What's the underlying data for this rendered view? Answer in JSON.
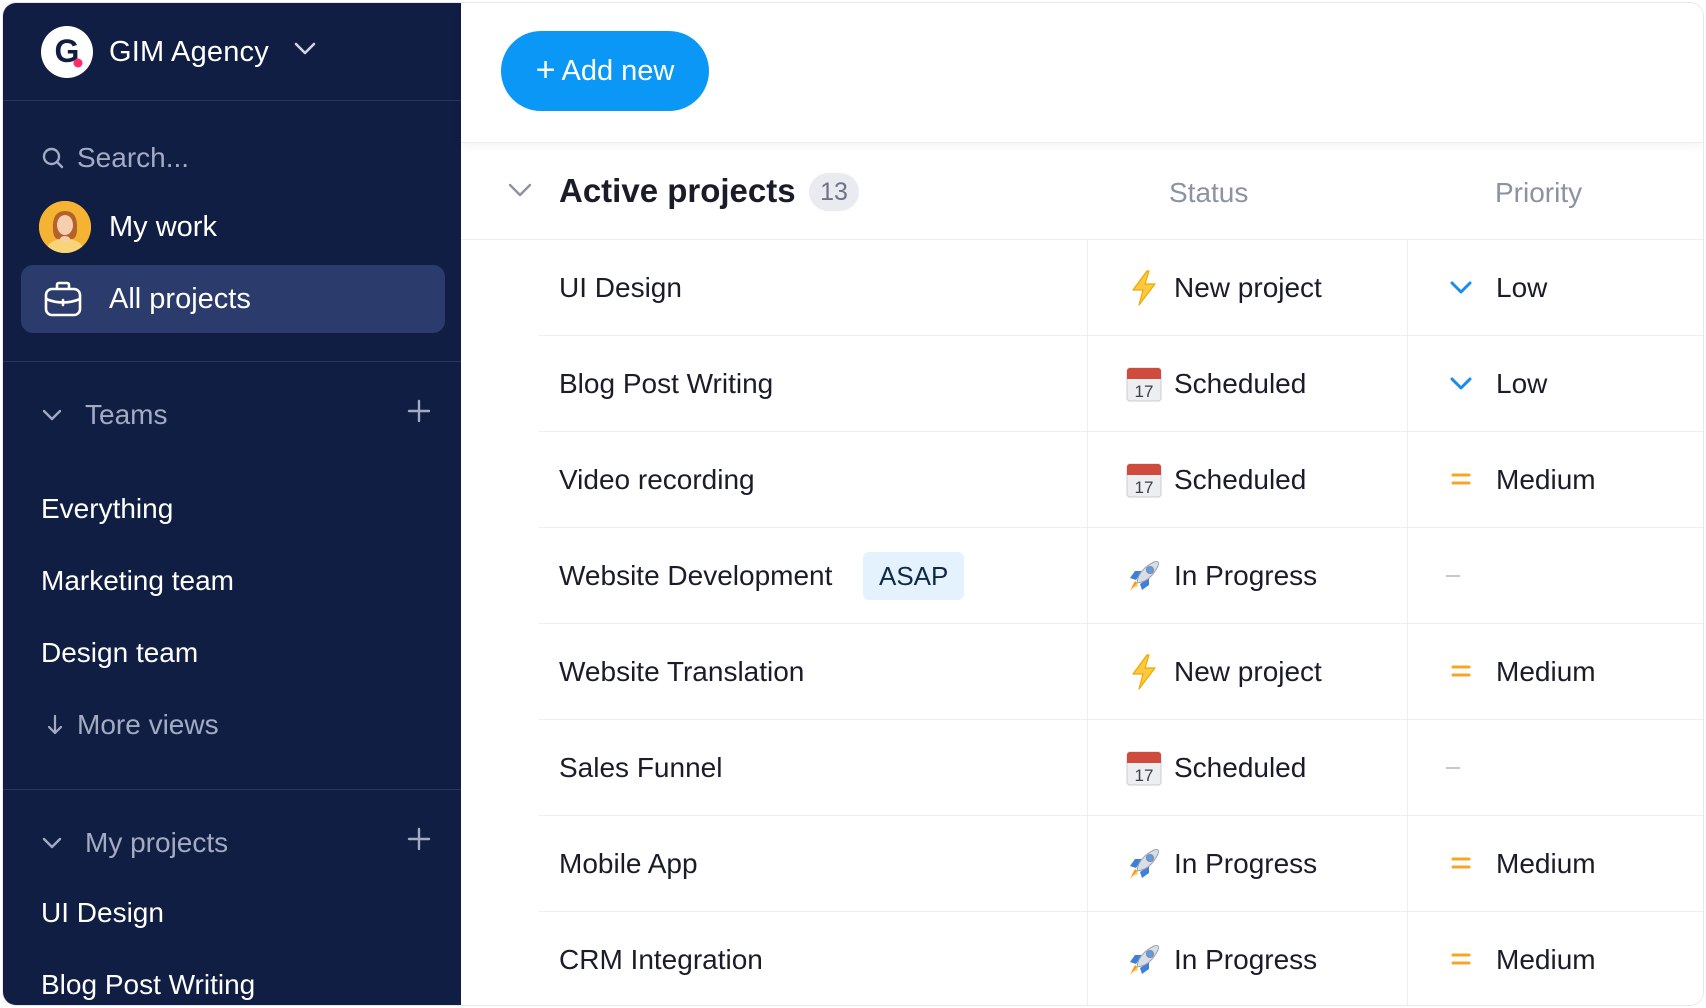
{
  "workspace": {
    "name": "GIM Agency",
    "logo_letter": "G"
  },
  "sidebar": {
    "search_placeholder": "Search...",
    "nav": [
      {
        "label": "My work",
        "icon": "avatar"
      },
      {
        "label": "All projects",
        "icon": "briefcase-icon",
        "active": true
      }
    ],
    "teams": {
      "title": "Teams",
      "items": [
        "Everything",
        "Marketing team",
        "Design team"
      ],
      "more_views": "More views"
    },
    "my_projects": {
      "title": "My projects",
      "items": [
        "UI Design",
        "Blog Post Writing"
      ]
    }
  },
  "toolbar": {
    "add_label": "Add new"
  },
  "group": {
    "title": "Active projects",
    "count": "13",
    "columns": {
      "status": "Status",
      "priority": "Priority"
    }
  },
  "rows": [
    {
      "name": "UI Design",
      "tag": "",
      "status": "New project",
      "status_icon": "lightning-icon",
      "priority": "Low",
      "priority_icon": "chevron-low-icon"
    },
    {
      "name": "Blog Post Writing",
      "tag": "",
      "status": "Scheduled",
      "status_icon": "calendar-icon",
      "priority": "Low",
      "priority_icon": "chevron-low-icon"
    },
    {
      "name": "Video recording",
      "tag": "",
      "status": "Scheduled",
      "status_icon": "calendar-icon",
      "priority": "Medium",
      "priority_icon": "equals-medium-icon"
    },
    {
      "name": "Website Development",
      "tag": "ASAP",
      "status": "In Progress",
      "status_icon": "rocket-icon",
      "priority": "",
      "priority_icon": "empty-dash"
    },
    {
      "name": "Website Translation",
      "tag": "",
      "status": "New project",
      "status_icon": "lightning-icon",
      "priority": "Medium",
      "priority_icon": "equals-medium-icon"
    },
    {
      "name": "Sales Funnel",
      "tag": "",
      "status": "Scheduled",
      "status_icon": "calendar-icon",
      "priority": "",
      "priority_icon": "empty-dash"
    },
    {
      "name": "Mobile App",
      "tag": "",
      "status": "In Progress",
      "status_icon": "rocket-icon",
      "priority": "Medium",
      "priority_icon": "equals-medium-icon"
    },
    {
      "name": "CRM Integration",
      "tag": "",
      "status": "In Progress",
      "status_icon": "rocket-icon",
      "priority": "Medium",
      "priority_icon": "equals-medium-icon"
    }
  ],
  "colors": {
    "sidebar_bg": "#111e43",
    "active_nav_bg": "#2b3b6b",
    "accent": "#0a97f5",
    "priority_low": "#1a8cf0",
    "priority_medium": "#f5a623"
  }
}
